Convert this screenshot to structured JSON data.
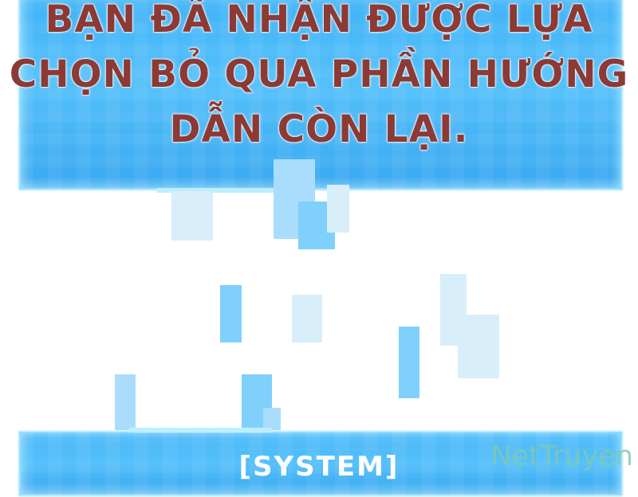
{
  "caption": {
    "line1": "BẠN ĐÃ NHẬN ĐƯỢC LỰA",
    "line2": "CHỌN BỎ QUA PHẦN HƯỚNG",
    "line3": "DẪN CÒN LẠI."
  },
  "system_panel": {
    "label": "[SYSTEM]"
  },
  "watermark": {
    "text": "NetTruyen"
  },
  "colors": {
    "panel_blue": "#4cbaf8",
    "caption_text": "#8b3a36",
    "watermark": "#82c8aa"
  }
}
